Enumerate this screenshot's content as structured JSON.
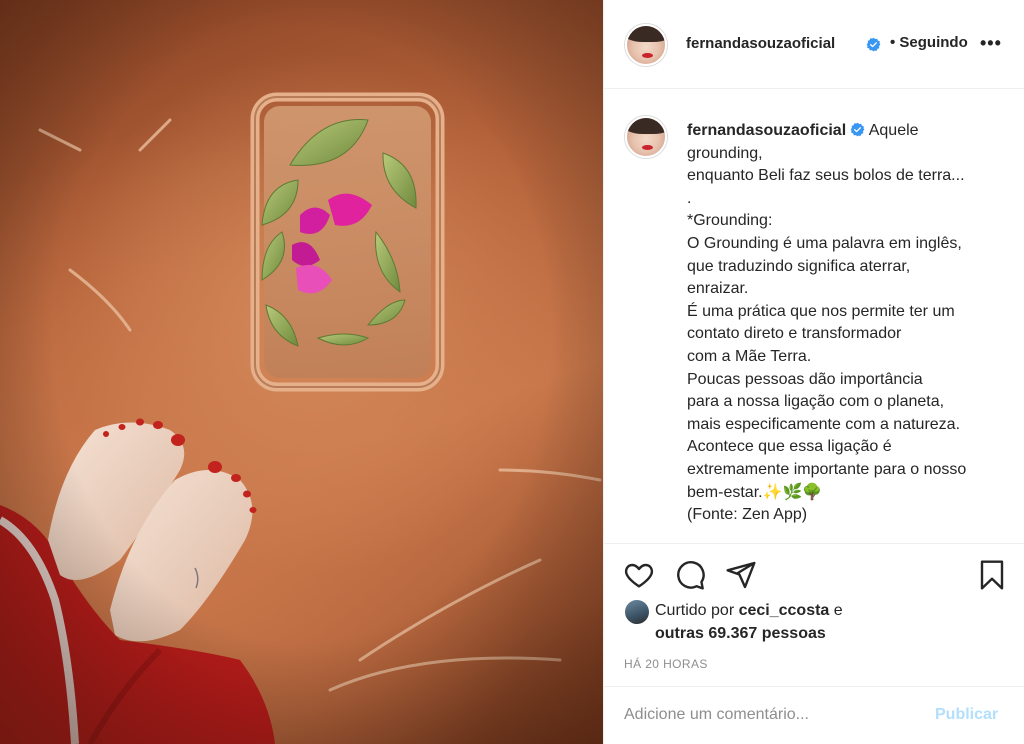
{
  "post": {
    "username": "fernandasouzaoficial",
    "follow_status": "• Seguindo",
    "more_label": "•••"
  },
  "caption": {
    "username": "fernandasouzaoficial",
    "text": " Aquele\ngrounding,\nenquanto Beli faz seus bolos de terra...\n.\n*Grounding:\nO Grounding é uma palavra em inglês,\nque traduzindo significa aterrar,\nenraizar.\nÉ uma prática que nos permite ter um\ncontato direto e transformador\ncom a Mãe Terra.\nPoucas pessoas dão importância\npara a nossa ligação com o planeta,\nmais especificamente com a natureza.\nAcontece que essa ligação é\nextremamente importante para o nosso\nbem-estar.✨🌿🌳\n(Fonte: Zen App)"
  },
  "likes": {
    "prefix": "Curtido por ",
    "liker": "ceci_ccosta",
    "suffix": " e",
    "others": "outras 69.367 pessoas"
  },
  "timestamp": "HÁ 20 HORAS",
  "comment": {
    "placeholder": "Adicione um comentário...",
    "publish_label": "Publicar"
  },
  "icons": {
    "like": "heart-icon",
    "comment": "comment-icon",
    "share": "paper-plane-icon",
    "save": "bookmark-icon",
    "verified": "verified-badge-icon",
    "more": "more-options-icon"
  },
  "colors": {
    "verified_blue": "#3897f0",
    "publish_disabled": "#b2dffc",
    "secondary_text": "#8e8e8e"
  }
}
